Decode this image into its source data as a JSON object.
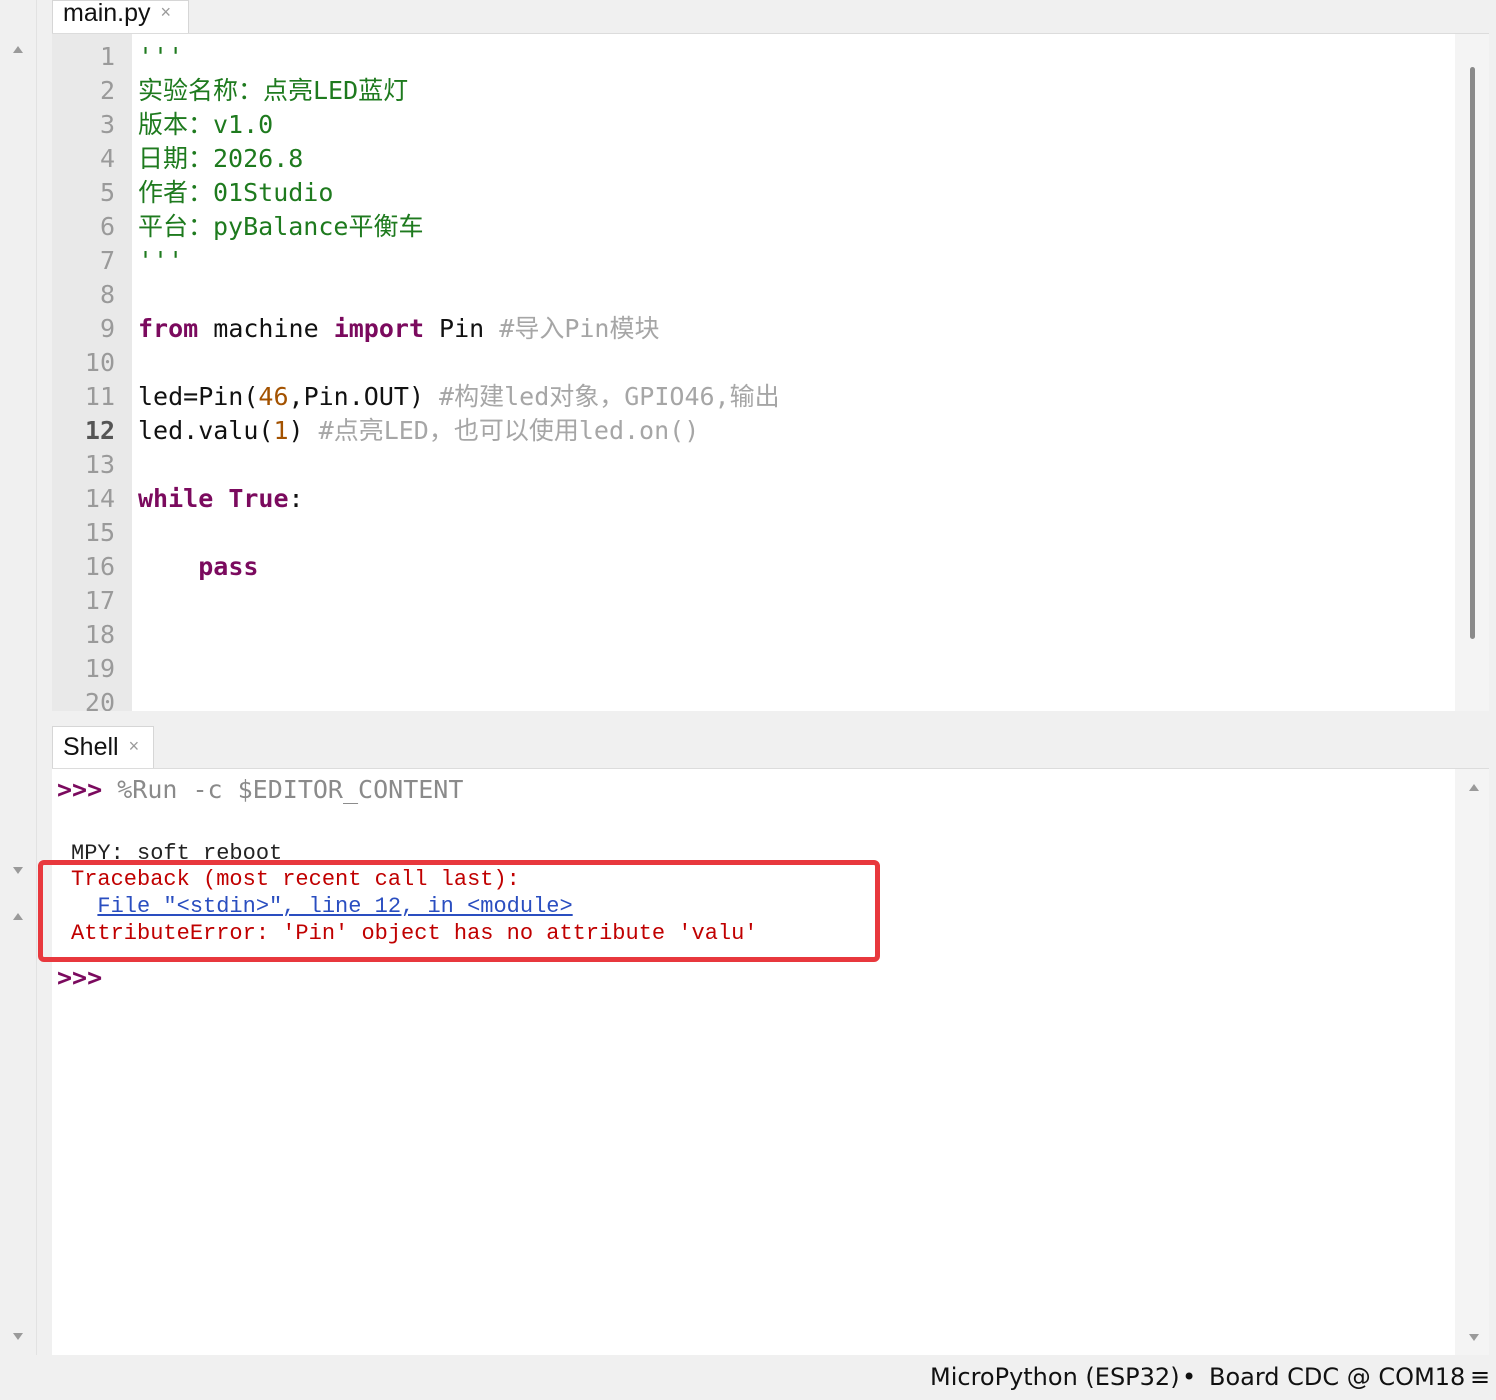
{
  "editor_tab": {
    "label": "main.py",
    "close": "×"
  },
  "shell_tab": {
    "label": "Shell",
    "close": "×"
  },
  "editor": {
    "line_numbers": [
      "1",
      "2",
      "3",
      "4",
      "5",
      "6",
      "7",
      "8",
      "9",
      "10",
      "11",
      "12",
      "13",
      "14",
      "15",
      "16",
      "17",
      "18",
      "19",
      "20"
    ],
    "active_line": "12",
    "lines": {
      "l1": "'''",
      "l2": "实验名称：点亮LED蓝灯",
      "l3": "版本：v1.0",
      "l4": "日期：2026.8",
      "l5": "作者：01Studio",
      "l6": "平台：pyBalance平衡车",
      "l7": "'''",
      "l9_kw1": "from",
      "l9_mid": " machine ",
      "l9_kw2": "import",
      "l9_end": " Pin ",
      "l9_cmt": "#导入Pin模块",
      "l11_a": "led=Pin(",
      "l11_num": "46",
      "l11_b": ",Pin.OUT) ",
      "l11_cmt": "#构建led对象，GPIO46,输出",
      "l12_a": "led.valu(",
      "l12_num": "1",
      "l12_b": ") ",
      "l12_cmt": "#点亮LED，也可以使用led.on()",
      "l14_kw1": "while",
      "l14_sp": " ",
      "l14_kw2": "True",
      "l14_end": ":",
      "l16_indent": "    ",
      "l16_kw": "pass"
    }
  },
  "shell": {
    "prompt": ">>>",
    "command": "%Run -c $EDITOR_CONTENT",
    "soft_reboot": "MPY: soft reboot",
    "traceback": "Traceback (most recent call last):",
    "file_link": "File \"<stdin>\", line 12, in <module>",
    "error": "AttributeError: 'Pin' object has no attribute 'valu'",
    "final_prompt": ">>>"
  },
  "status_bar": {
    "interpreter": "MicroPython (ESP32)",
    "separator": "•",
    "port": "Board CDC @ COM18",
    "menu": "≡"
  },
  "colors": {
    "string": "#1e7a1e",
    "keyword": "#7b0a5e",
    "comment": "#a6a6a6",
    "number": "#a35200",
    "error": "#c00000",
    "link": "#2a4ec0",
    "highlight_box": "#e8383d"
  }
}
